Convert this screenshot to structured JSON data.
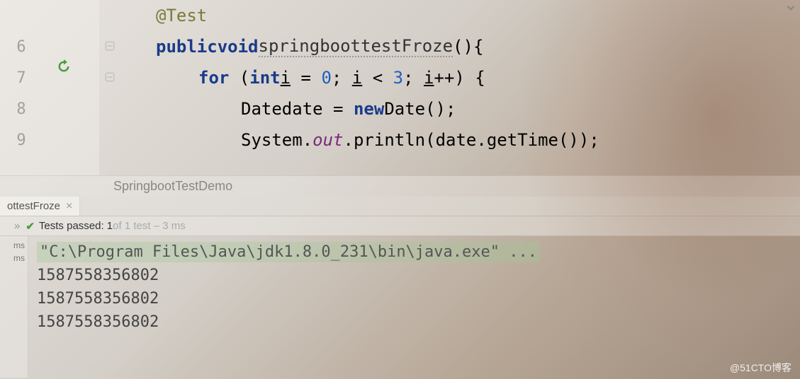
{
  "editor": {
    "lines": [
      {
        "num": "",
        "annotation": "@Test"
      },
      {
        "num": "6"
      },
      {
        "num": "7"
      },
      {
        "num": "8"
      },
      {
        "num": "9"
      }
    ],
    "code": {
      "publicKw": "public",
      "voidKw": "void",
      "methodName": "springboottestFroze",
      "forKw": "for",
      "intKw": "int",
      "iVar": "i",
      "zero": "0",
      "three": "3",
      "dateType": "Date",
      "dateVar": "date",
      "newKw": "new",
      "system": "System",
      "outField": "out",
      "println": "println",
      "getTime": "getTime"
    }
  },
  "breadcrumb": {
    "item": "SpringbootTestDemo"
  },
  "tab": {
    "label": "ottestFroze",
    "close": "×"
  },
  "testStatus": {
    "chevron": "»",
    "check": "✔",
    "passedLabel": "Tests passed: 1",
    "detail": " of 1 test – 3 ms"
  },
  "console": {
    "sidebar": {
      "ms1": "ms",
      "ms2": "ms"
    },
    "cmd": "\"C:\\Program Files\\Java\\jdk1.8.0_231\\bin\\java.exe\" ...",
    "out1": "1587558356802",
    "out2": "1587558356802",
    "out3": "1587558356802"
  },
  "watermark": "@51CTO博客"
}
